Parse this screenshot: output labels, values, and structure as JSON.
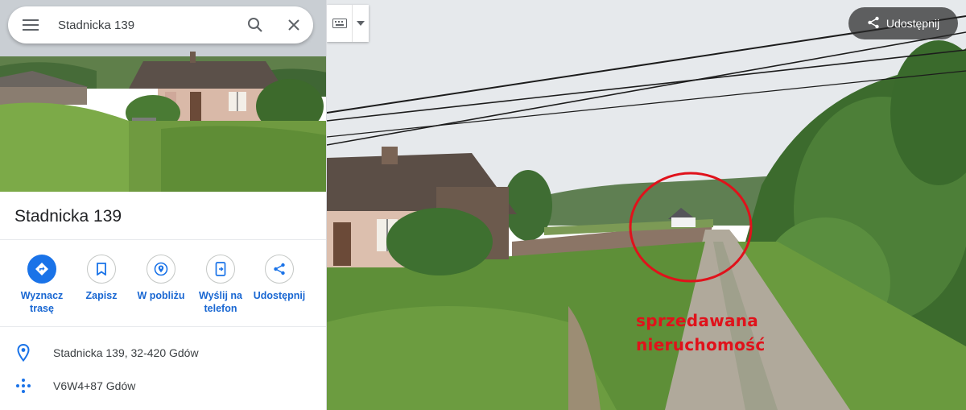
{
  "search": {
    "query": "Stadnicka 139"
  },
  "place": {
    "title": "Stadnicka 139"
  },
  "actions": [
    {
      "label": "Wyznacz trasę"
    },
    {
      "label": "Zapisz"
    },
    {
      "label": "W pobliżu"
    },
    {
      "label": "Wyślij na telefon"
    },
    {
      "label": "Udostępnij"
    }
  ],
  "info": {
    "address": "Stadnicka 139, 32-420 Gdów",
    "plus_code": "V6W4+87 Gdów"
  },
  "streetview": {
    "share_label": "Udostępnij",
    "annotation_line1": "sprzedawana",
    "annotation_line2": "nieruchomość"
  },
  "colors": {
    "accent": "#1a73e8",
    "annotation": "#e0121b"
  }
}
